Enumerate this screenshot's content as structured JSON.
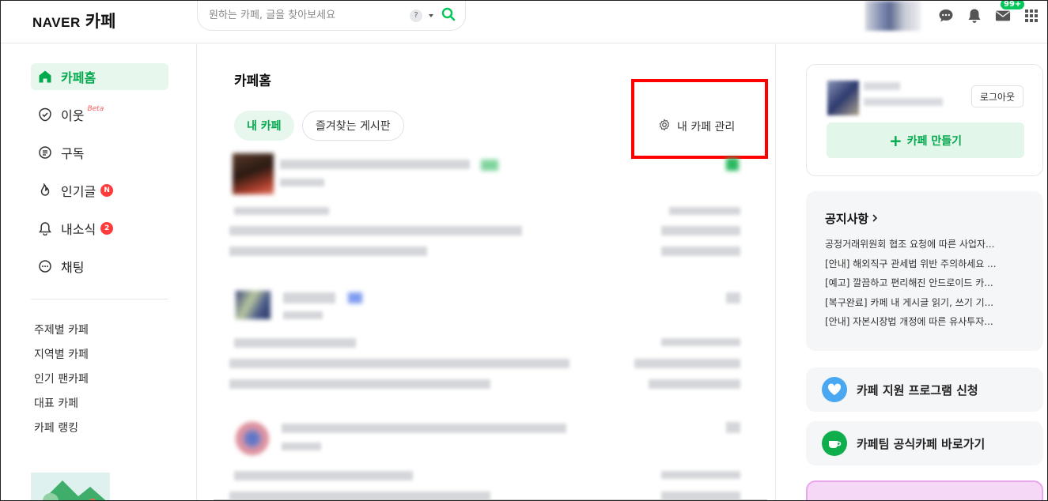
{
  "header": {
    "logo_brand": "NAVER",
    "logo_service": "카페",
    "search_placeholder": "원하는 카페, 글을 찾아보세요",
    "search_help": "?",
    "mail_badge": "99+"
  },
  "sidebar": {
    "nav": [
      {
        "label": "카페홈",
        "icon": "home-icon",
        "active": true
      },
      {
        "label": "이웃",
        "icon": "check-circle-icon",
        "extra": "Beta"
      },
      {
        "label": "구독",
        "icon": "document-icon"
      },
      {
        "label": "인기글",
        "icon": "flame-icon",
        "badge": "N"
      },
      {
        "label": "내소식",
        "icon": "bell-icon",
        "badge": "2"
      },
      {
        "label": "채팅",
        "icon": "chat-bubble-icon"
      }
    ],
    "sub": [
      "주제별 카페",
      "지역별 카페",
      "인기 팬카페",
      "대표 카페",
      "카페 랭킹"
    ]
  },
  "main": {
    "title": "카페홈",
    "tabs": [
      "내 카페",
      "즐겨찾는 게시판"
    ],
    "manage_label": "내 카페 관리"
  },
  "right": {
    "logout": "로그아웃",
    "create_label": "카페 만들기",
    "notice_title": "공지사항",
    "notices": [
      "공정거래위원회 협조 요청에 따른 사업자...",
      "[안내] 해외직구 관세법 위반 주의하세요 ...",
      "[예고] 깔끔하고 편리해진 안드로이드 카...",
      "[복구완료] 카페 내 게시글 읽기, 쓰기 기...",
      "[안내] 자본시장법 개정에 따른 유사투자..."
    ],
    "promo1": "카페 지원 프로그램 신청",
    "promo2": "카페팀 공식카페 바로가기"
  },
  "colors": {
    "accent": "#03c75a",
    "highlight_box": "#ff0000",
    "badge_red": "#ff3b3b"
  }
}
